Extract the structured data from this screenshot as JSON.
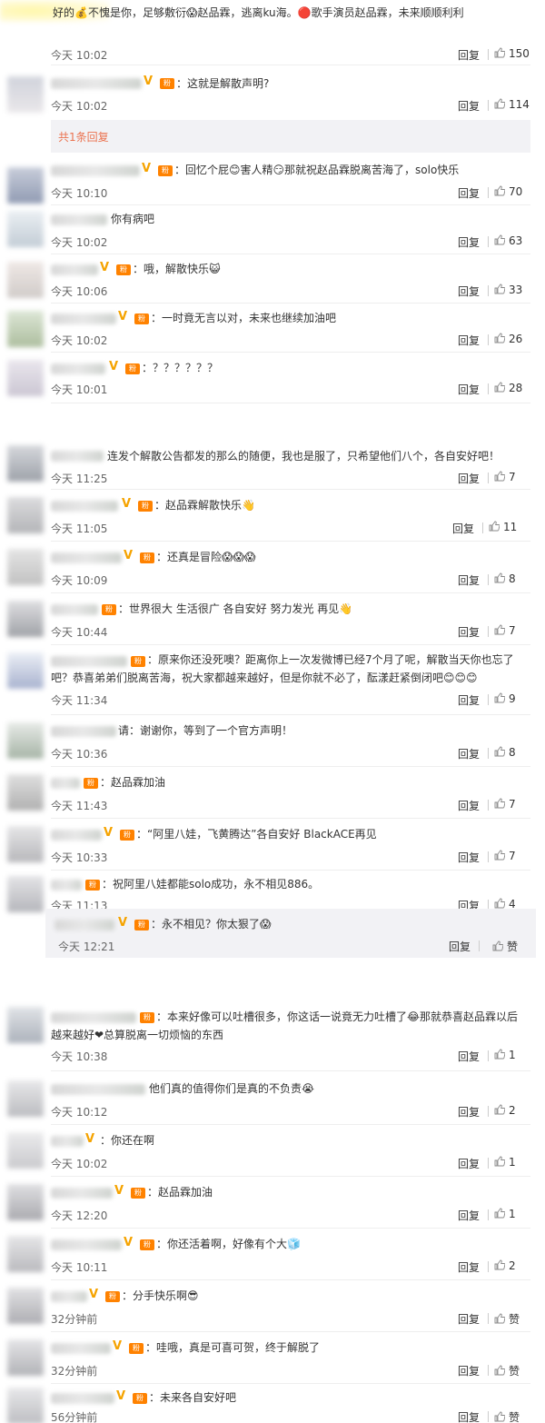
{
  "sections": [
    {
      "comments": [
        {
          "text": "好的💰不愧是你，足够敷衍😱赵品霖，逃离ku海。🔴歌手演员赵品霖，未来顺顺利利",
          "time": "今天 10:02",
          "reply": "回复",
          "likes": "150"
        },
        {
          "text": "：这就是解散声明?",
          "time": "今天 10:02",
          "reply": "回复",
          "likes": "114",
          "expand": "共1条回复"
        },
        {
          "text": "：回忆个屁😊害人精😏那就祝赵品霖脱离苦海了，solo快乐",
          "time": "今天 10:10",
          "reply": "回复",
          "likes": "70"
        },
        {
          "text": "你有病吧",
          "time": "今天 10:02",
          "reply": "回复",
          "likes": "63"
        },
        {
          "text": "：哦，解散快乐😺",
          "time": "今天 10:06",
          "reply": "回复",
          "likes": "33"
        },
        {
          "text": "：一时竟无言以对，未来也继续加油吧",
          "time": "今天 10:02",
          "reply": "回复",
          "likes": "26"
        },
        {
          "text": "：？？？？？？",
          "time": "今天 10:01",
          "reply": "回复",
          "likes": "28"
        }
      ]
    },
    {
      "comments": [
        {
          "text": "连发个解散公告都发的那么的随便，我也是服了，只希望他们八个，各自安好吧！",
          "time": "今天 11:25",
          "reply": "回复",
          "likes": "7"
        },
        {
          "text": "：赵品霖解散快乐👋",
          "time": "今天 11:05",
          "reply": "回复",
          "likes": "11"
        },
        {
          "text": "：还真是冒险😱😱😱",
          "time": "今天 10:09",
          "reply": "回复",
          "likes": "8"
        },
        {
          "text": "：世界很大 生活很广 各自安好 努力发光 再见👋",
          "time": "今天 10:44",
          "reply": "回复",
          "likes": "7"
        },
        {
          "text": "：原来你还没死噢？距离你上一次发微博已经7个月了呢，解散当天你也忘了吧？恭喜弟弟们脱离苦海，祝大家都越来越好，但是你就不必了，酝漾赶紧倒闭吧😊😊😊",
          "time": "今天 11:34",
          "reply": "回复",
          "likes": "9"
        },
        {
          "text": "请：谢谢你，等到了一个官方声明！",
          "time": "今天 10:36",
          "reply": "回复",
          "likes": "8"
        },
        {
          "text": "：赵品霖加油",
          "time": "今天 11:43",
          "reply": "回复",
          "likes": "7"
        },
        {
          "text": "：“阿里八娃，飞黄腾达”各自安好 BlackACE再见",
          "time": "今天 10:33",
          "reply": "回复",
          "likes": "7"
        },
        {
          "text": "：祝阿里八娃都能solo成功，永不相见886。",
          "time": "今天 11:13",
          "reply": "回复",
          "likes": "4"
        },
        {
          "text": "：永不相见？你太狠了😱",
          "time": "今天 12:21",
          "reply": "回复",
          "likes": "赞"
        }
      ]
    },
    {
      "comments": [
        {
          "text": "：本来好像可以吐槽很多，你这话一说竟无力吐槽了😂那就恭喜赵品霖以后越来越好❤总算脱离一切烦恼的东西",
          "time": "今天 10:38",
          "reply": "回复",
          "likes": "1"
        },
        {
          "text": "他们真的值得你们是真的不负责😭",
          "time": "今天 10:12",
          "reply": "回复",
          "likes": "2"
        },
        {
          "text": "：你还在啊",
          "time": "今天 10:02",
          "reply": "回复",
          "likes": "1"
        },
        {
          "text": "：赵品霖加油",
          "time": "今天 12:20",
          "reply": "回复",
          "likes": "1"
        },
        {
          "text": "：你还活着啊，好像有个大🧊",
          "time": "今天 10:11",
          "reply": "回复",
          "likes": "2"
        },
        {
          "text": "：分手快乐啊😎",
          "time": "32分钟前",
          "reply": "回复",
          "likes": "赞"
        },
        {
          "text": "：哇哦，真是可喜可贺，终于解脱了",
          "time": "32分钟前",
          "reply": "回复",
          "likes": "赞"
        },
        {
          "text": "：未来各自安好吧",
          "time": "56分钟前",
          "reply": "回复",
          "likes": "赞"
        }
      ]
    }
  ]
}
